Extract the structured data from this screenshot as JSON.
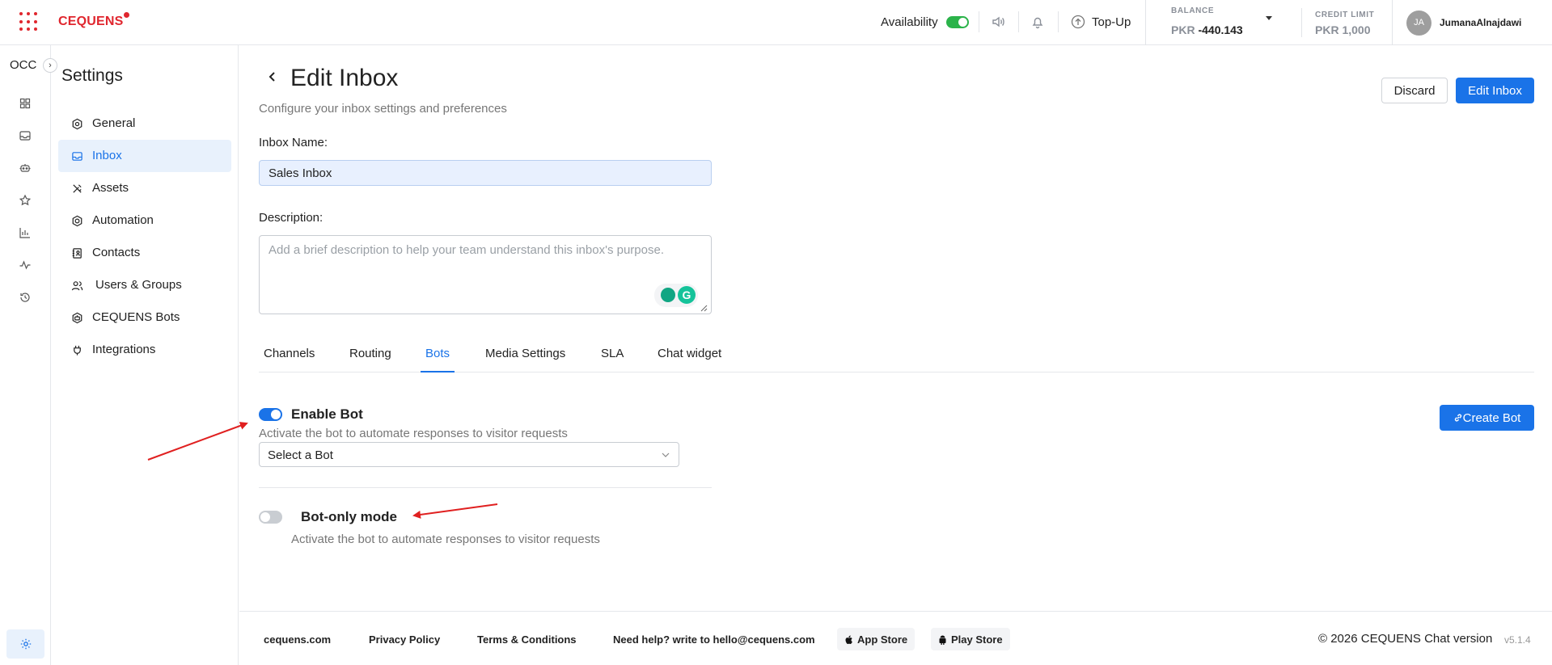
{
  "topbar": {
    "brand": "CEQUENS",
    "availability_label": "Availability",
    "availability_on": true,
    "topup_label": "Top-Up",
    "balance_caption": "BALANCE",
    "balance_currency": "PKR",
    "balance_value": "-440.143",
    "credit_caption": "CREDIT LIMIT",
    "credit_value": "PKR 1,000",
    "avatar_initials": "JA",
    "username": "JumanaAlnajdawi"
  },
  "rail": {
    "title": "OCC",
    "expand_glyph": "›",
    "icons": [
      "dashboard-icon",
      "inbox-icon",
      "bot-icon",
      "star-icon",
      "bar-chart-icon",
      "activity-icon",
      "history-icon"
    ],
    "bottom_icon": "settings-icon"
  },
  "sidebar": {
    "title": "Settings",
    "items": [
      {
        "label": "General",
        "icon": "gear-icon",
        "active": false
      },
      {
        "label": "Inbox",
        "icon": "inbox-icon",
        "active": true
      },
      {
        "label": "Assets",
        "icon": "tools-icon",
        "active": false
      },
      {
        "label": "Automation",
        "icon": "hexagon-gear-icon",
        "active": false
      },
      {
        "label": "Contacts",
        "icon": "contacts-book-icon",
        "active": false
      },
      {
        "label": "Users & Groups",
        "icon": "users-icon",
        "active": false
      },
      {
        "label": "CEQUENS Bots",
        "icon": "bot-icon",
        "active": false
      },
      {
        "label": "Integrations",
        "icon": "plug-icon",
        "active": false
      }
    ]
  },
  "main": {
    "title": "Edit Inbox",
    "subtitle": "Configure your inbox settings and preferences",
    "discard_label": "Discard",
    "save_label": "Edit Inbox",
    "inbox_name_label": "Inbox Name:",
    "inbox_name_value": "Sales Inbox",
    "description_label": "Description:",
    "description_placeholder": "Add a brief description to help your team understand this inbox's purpose.",
    "tabs": [
      {
        "label": "Channels",
        "active": false
      },
      {
        "label": "Routing",
        "active": false
      },
      {
        "label": "Bots",
        "active": true
      },
      {
        "label": "Media Settings",
        "active": false
      },
      {
        "label": "SLA",
        "active": false
      },
      {
        "label": "Chat widget",
        "active": false
      }
    ],
    "bots": {
      "enable_label": "Enable Bot",
      "enable_on": true,
      "enable_desc": "Activate the bot to automate responses to visitor requests",
      "select_placeholder": "Select a Bot",
      "create_label": "Create Bot",
      "bot_only_label": "Bot-only mode",
      "bot_only_on": false,
      "bot_only_desc": "Activate the bot to automate responses to visitor requests"
    }
  },
  "footer": {
    "site": "cequens.com",
    "privacy": "Privacy Policy",
    "terms": "Terms & Conditions",
    "help": "Need help? write to hello@cequens.com",
    "app_store": "App Store",
    "play_store": "Play Store",
    "copyright": "© 2026 CEQUENS Chat version",
    "version": "v5.1.4"
  },
  "colors": {
    "brand_red": "#e0262e",
    "accent_blue": "#1a73e8",
    "availability_green": "#2bb34a",
    "annotation_arrow": "#e02020"
  }
}
